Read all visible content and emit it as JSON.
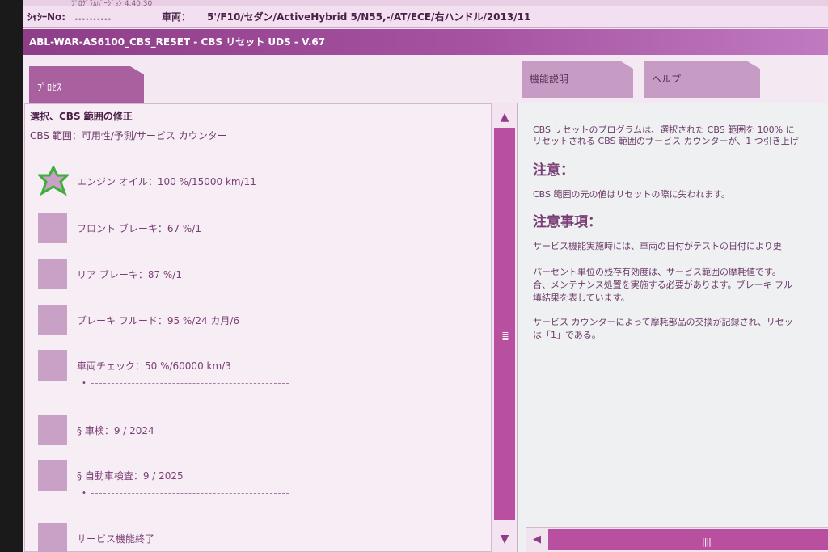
{
  "top_strip": {
    "text": "ﾌﾟﾛｸﾞﾗﾑﾊﾞｰｼﾞｮﾝ 4.40.30"
  },
  "vehicle": {
    "chassis_label": "ｼｬｼｰNo:",
    "chassis_value": "..........",
    "car_label": "車両：",
    "car_value": "5'/F10/セダン/ActiveHybrid 5/N55,-/AT/ECE/右ハンドル/2013/11"
  },
  "title": "ABL-WAR-AS6100_CBS_RESET - CBS リセット UDS - V.67",
  "tabs": {
    "process": "ﾌﾟﾛｾｽ",
    "function": "機能説明",
    "help": "ヘルプ"
  },
  "left": {
    "heading": "選択、CBS 範囲の修正",
    "subheading": "CBS 範囲：可用性/予測/サービス カウンター",
    "items": [
      {
        "label": "エンジン オイル：100 %/15000 km/11",
        "icon": "star-icon"
      },
      {
        "label": "フロント ブレーキ：67 %/1",
        "icon": "box"
      },
      {
        "label": "リア ブレーキ：87 %/1",
        "icon": "box"
      },
      {
        "label": "ブレーキ フルード：95 %/24 カ月/6",
        "icon": "box"
      },
      {
        "label": "車両チェック：50 %/60000 km/3",
        "icon": "box"
      },
      {
        "label": "§ 車検：9 / 2024",
        "icon": "box"
      },
      {
        "label": "§ 自動車検査：9 / 2025",
        "icon": "box"
      },
      {
        "label": "サービス機能終了",
        "icon": "box"
      }
    ]
  },
  "right": {
    "intro_line1": "CBS リセットのプログラムは、選択された CBS 範囲を 100% に",
    "intro_line2": "リセットされる CBS 範囲のサービス カウンターが、1 つ引き上げ",
    "caution_heading": "注意：",
    "caution_text": "CBS 範囲の元の値はリセットの際に失われます。",
    "notes_heading": "注意事項：",
    "note1": "サービス機能実施時には、車両の日付がテストの日付により更",
    "note2_line1": "パーセント単位の残存有効度は、サービス範囲の摩耗値です。",
    "note2_line2": "合、メンテナンス処置を実施する必要があります。ブレーキ フル",
    "note2_line3": "填結果を表しています。",
    "note3_line1": "サービス カウンターによって摩耗部品の交換が記録され、リセッ",
    "note3_line2": "は「1」である。"
  },
  "colors": {
    "accent": "#8e3d88",
    "scroll": "#b8509f",
    "star": "#3fae3a"
  }
}
